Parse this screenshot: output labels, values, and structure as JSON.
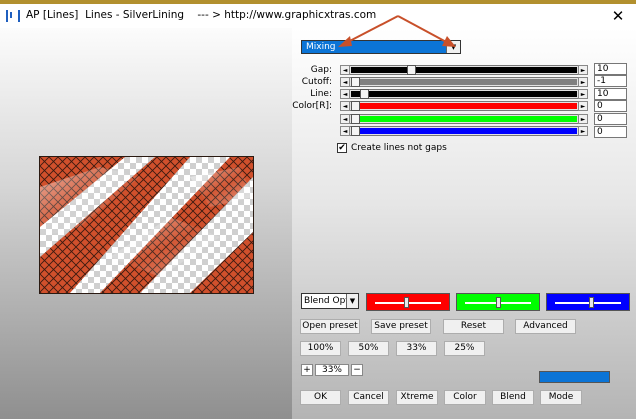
{
  "window": {
    "title": "AP [Lines]  Lines - SilverLining    --- > http://www.graphicxtras.com",
    "close": "✕"
  },
  "mode_select": {
    "value": "Mixing",
    "arrow": "▼"
  },
  "controls": {
    "gap": {
      "label": "Gap:",
      "value": "10",
      "position": 0.26,
      "track_color": "#000000"
    },
    "cutoff": {
      "label": "Cutoff:",
      "value": "-1",
      "position": 0.0,
      "track_color": "#808080"
    },
    "line": {
      "label": "Line:",
      "value": "10",
      "position": 0.04,
      "track_color": "#000000"
    },
    "color_r": {
      "label": "Color[R]:",
      "value": "0",
      "position": 0.0,
      "track_color": "#ff0000"
    },
    "color_g": {
      "value": "0",
      "position": 0.0,
      "track_color": "#00ff00"
    },
    "color_b": {
      "value": "0",
      "position": 0.0,
      "track_color": "#0000ff"
    }
  },
  "checkbox": {
    "label": "Create lines not gaps",
    "checked": true,
    "mark": "✔"
  },
  "blend_select": {
    "value": "Blend Options",
    "arrow": "▼"
  },
  "color_sliders": [
    {
      "name": "red",
      "color": "#ff0000",
      "position": 0.48
    },
    {
      "name": "green",
      "color": "#00ff00",
      "position": 0.5
    },
    {
      "name": "blue",
      "color": "#0000ff",
      "position": 0.55
    }
  ],
  "buttons": {
    "open_preset": "Open preset",
    "save_preset": "Save preset",
    "reset": "Reset",
    "advanced": "Advanced",
    "z100": "100%",
    "z50": "50%",
    "z33": "33%",
    "z25": "25%",
    "ok": "OK",
    "cancel": "Cancel",
    "xtreme": "Xtreme",
    "color": "Color",
    "blend": "Blend",
    "mode": "Mode"
  },
  "zoom": {
    "plus": "+",
    "value": "33%",
    "minus": "−"
  },
  "arrow_symbols": {
    "left": "◄",
    "right": "►"
  },
  "colors": {
    "accent_blue": "#0b74d6",
    "callout_arrow": "#c8502a",
    "preview_orange": "#d0502c"
  }
}
